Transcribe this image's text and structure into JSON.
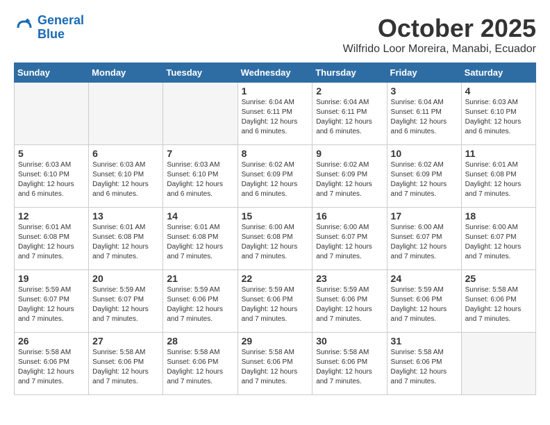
{
  "logo": {
    "line1": "General",
    "line2": "Blue"
  },
  "title": "October 2025",
  "subtitle": "Wilfrido Loor Moreira, Manabi, Ecuador",
  "weekdays": [
    "Sunday",
    "Monday",
    "Tuesday",
    "Wednesday",
    "Thursday",
    "Friday",
    "Saturday"
  ],
  "weeks": [
    [
      {
        "day": "",
        "info": ""
      },
      {
        "day": "",
        "info": ""
      },
      {
        "day": "",
        "info": ""
      },
      {
        "day": "1",
        "info": "Sunrise: 6:04 AM\nSunset: 6:11 PM\nDaylight: 12 hours\nand 6 minutes."
      },
      {
        "day": "2",
        "info": "Sunrise: 6:04 AM\nSunset: 6:11 PM\nDaylight: 12 hours\nand 6 minutes."
      },
      {
        "day": "3",
        "info": "Sunrise: 6:04 AM\nSunset: 6:11 PM\nDaylight: 12 hours\nand 6 minutes."
      },
      {
        "day": "4",
        "info": "Sunrise: 6:03 AM\nSunset: 6:10 PM\nDaylight: 12 hours\nand 6 minutes."
      }
    ],
    [
      {
        "day": "5",
        "info": "Sunrise: 6:03 AM\nSunset: 6:10 PM\nDaylight: 12 hours\nand 6 minutes."
      },
      {
        "day": "6",
        "info": "Sunrise: 6:03 AM\nSunset: 6:10 PM\nDaylight: 12 hours\nand 6 minutes."
      },
      {
        "day": "7",
        "info": "Sunrise: 6:03 AM\nSunset: 6:10 PM\nDaylight: 12 hours\nand 6 minutes."
      },
      {
        "day": "8",
        "info": "Sunrise: 6:02 AM\nSunset: 6:09 PM\nDaylight: 12 hours\nand 6 minutes."
      },
      {
        "day": "9",
        "info": "Sunrise: 6:02 AM\nSunset: 6:09 PM\nDaylight: 12 hours\nand 7 minutes."
      },
      {
        "day": "10",
        "info": "Sunrise: 6:02 AM\nSunset: 6:09 PM\nDaylight: 12 hours\nand 7 minutes."
      },
      {
        "day": "11",
        "info": "Sunrise: 6:01 AM\nSunset: 6:08 PM\nDaylight: 12 hours\nand 7 minutes."
      }
    ],
    [
      {
        "day": "12",
        "info": "Sunrise: 6:01 AM\nSunset: 6:08 PM\nDaylight: 12 hours\nand 7 minutes."
      },
      {
        "day": "13",
        "info": "Sunrise: 6:01 AM\nSunset: 6:08 PM\nDaylight: 12 hours\nand 7 minutes."
      },
      {
        "day": "14",
        "info": "Sunrise: 6:01 AM\nSunset: 6:08 PM\nDaylight: 12 hours\nand 7 minutes."
      },
      {
        "day": "15",
        "info": "Sunrise: 6:00 AM\nSunset: 6:08 PM\nDaylight: 12 hours\nand 7 minutes."
      },
      {
        "day": "16",
        "info": "Sunrise: 6:00 AM\nSunset: 6:07 PM\nDaylight: 12 hours\nand 7 minutes."
      },
      {
        "day": "17",
        "info": "Sunrise: 6:00 AM\nSunset: 6:07 PM\nDaylight: 12 hours\nand 7 minutes."
      },
      {
        "day": "18",
        "info": "Sunrise: 6:00 AM\nSunset: 6:07 PM\nDaylight: 12 hours\nand 7 minutes."
      }
    ],
    [
      {
        "day": "19",
        "info": "Sunrise: 5:59 AM\nSunset: 6:07 PM\nDaylight: 12 hours\nand 7 minutes."
      },
      {
        "day": "20",
        "info": "Sunrise: 5:59 AM\nSunset: 6:07 PM\nDaylight: 12 hours\nand 7 minutes."
      },
      {
        "day": "21",
        "info": "Sunrise: 5:59 AM\nSunset: 6:06 PM\nDaylight: 12 hours\nand 7 minutes."
      },
      {
        "day": "22",
        "info": "Sunrise: 5:59 AM\nSunset: 6:06 PM\nDaylight: 12 hours\nand 7 minutes."
      },
      {
        "day": "23",
        "info": "Sunrise: 5:59 AM\nSunset: 6:06 PM\nDaylight: 12 hours\nand 7 minutes."
      },
      {
        "day": "24",
        "info": "Sunrise: 5:59 AM\nSunset: 6:06 PM\nDaylight: 12 hours\nand 7 minutes."
      },
      {
        "day": "25",
        "info": "Sunrise: 5:58 AM\nSunset: 6:06 PM\nDaylight: 12 hours\nand 7 minutes."
      }
    ],
    [
      {
        "day": "26",
        "info": "Sunrise: 5:58 AM\nSunset: 6:06 PM\nDaylight: 12 hours\nand 7 minutes."
      },
      {
        "day": "27",
        "info": "Sunrise: 5:58 AM\nSunset: 6:06 PM\nDaylight: 12 hours\nand 7 minutes."
      },
      {
        "day": "28",
        "info": "Sunrise: 5:58 AM\nSunset: 6:06 PM\nDaylight: 12 hours\nand 7 minutes."
      },
      {
        "day": "29",
        "info": "Sunrise: 5:58 AM\nSunset: 6:06 PM\nDaylight: 12 hours\nand 7 minutes."
      },
      {
        "day": "30",
        "info": "Sunrise: 5:58 AM\nSunset: 6:06 PM\nDaylight: 12 hours\nand 7 minutes."
      },
      {
        "day": "31",
        "info": "Sunrise: 5:58 AM\nSunset: 6:06 PM\nDaylight: 12 hours\nand 7 minutes."
      },
      {
        "day": "",
        "info": ""
      }
    ]
  ]
}
